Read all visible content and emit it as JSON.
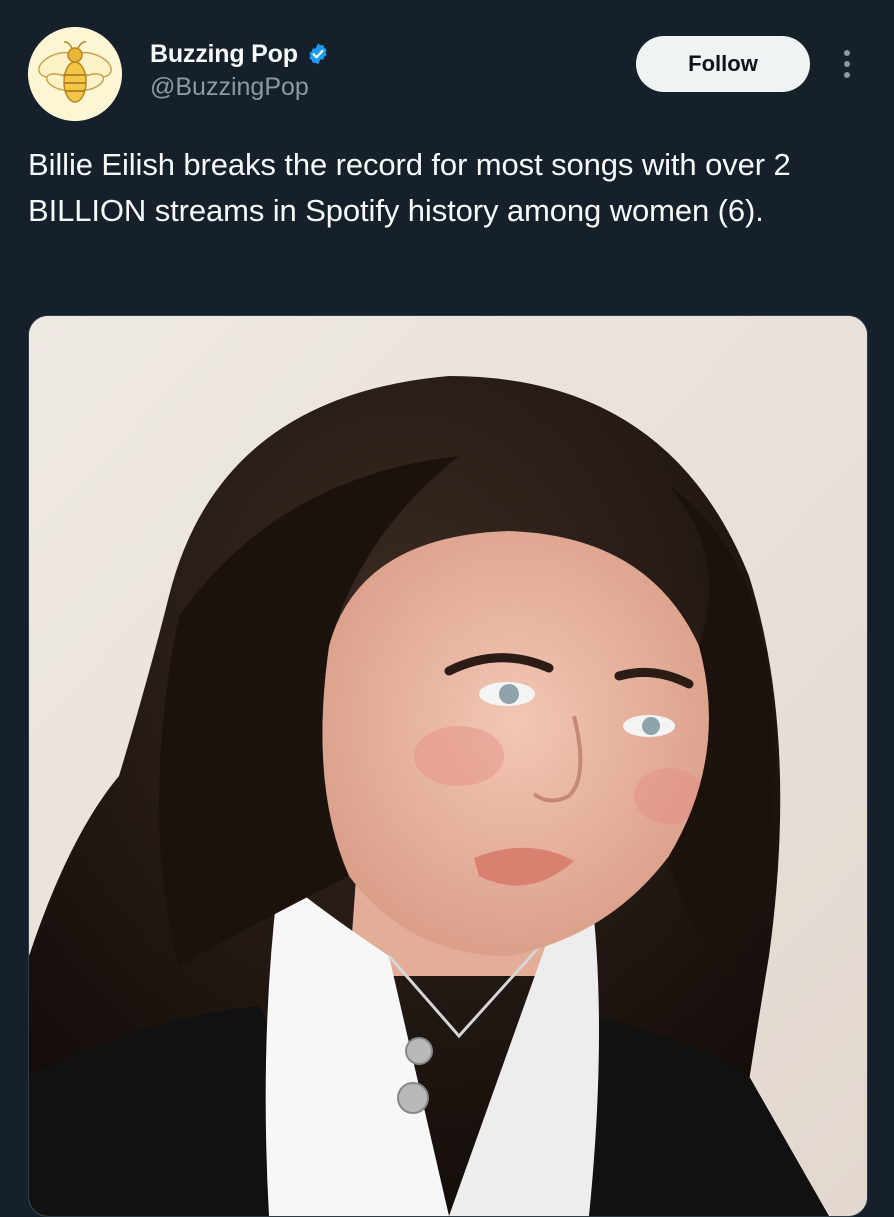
{
  "user": {
    "display_name": "Buzzing Pop",
    "handle": "@BuzzingPop",
    "verified": true,
    "avatar_icon": "bee-icon"
  },
  "actions": {
    "follow_label": "Follow",
    "more_icon": "more-vertical-icon"
  },
  "tweet": {
    "text": "Billie Eilish breaks the record for most songs with over 2 BILLION streams in Spotify history among women (6)."
  },
  "colors": {
    "background": "#15202b",
    "verified": "#1d9bf0",
    "follow_bg": "#eff3f4",
    "secondary_text": "#8b98a5"
  }
}
